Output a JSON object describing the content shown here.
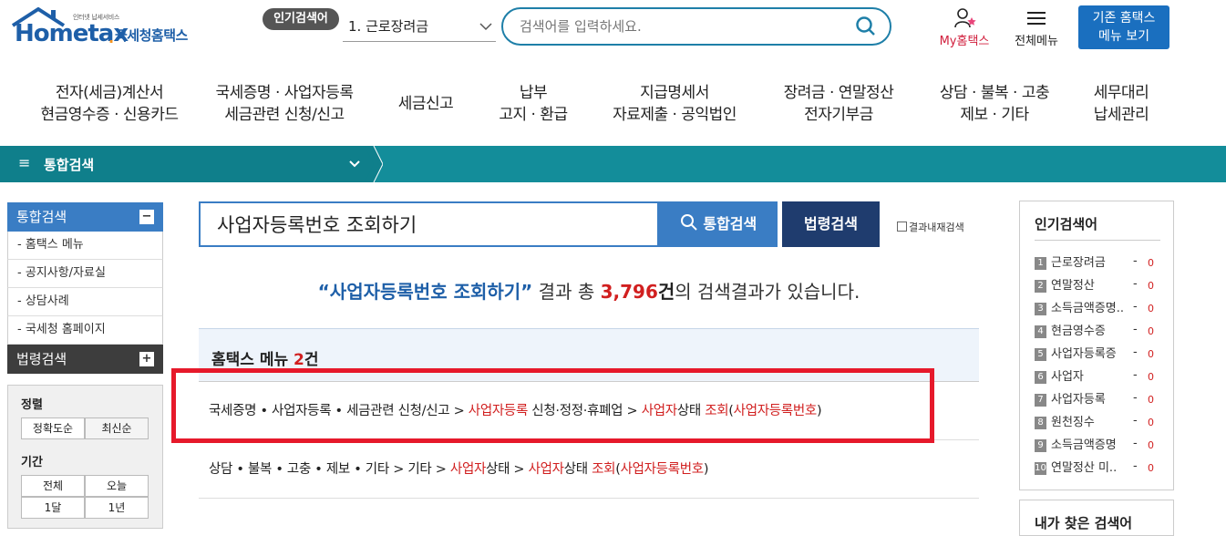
{
  "header": {
    "logo_small": "인터넷 납세서비스",
    "logo_brand": "Hometax",
    "logo_kor": "국세청홈택스",
    "popular_badge": "인기검색어",
    "popular_selected": "1.  근로장려금",
    "search_placeholder": "검색어를 입력하세요.",
    "my_hometax": "My홈택스",
    "all_menu": "전체메뉴",
    "old_menu_line1": "기존 홈택스",
    "old_menu_line2": "메뉴 보기"
  },
  "nav": [
    {
      "l1": "전자(세금)계산서",
      "l2": "현금영수증 · 신용카드"
    },
    {
      "l1": "국세증명 · 사업자등록",
      "l2": "세금관련 신청/신고"
    },
    {
      "l1": "세금신고",
      "l2": ""
    },
    {
      "l1": "납부",
      "l2": "고지 · 환급"
    },
    {
      "l1": "지급명세서",
      "l2": "자료제출 · 공익법인"
    },
    {
      "l1": "장려금 · 연말정산",
      "l2": "전자기부금"
    },
    {
      "l1": "상담 · 불복 · 고충",
      "l2": "제보 · 기타"
    },
    {
      "l1": "세무대리",
      "l2": "납세관리"
    }
  ],
  "teal_bar": {
    "title": "통합검색"
  },
  "left": {
    "integrated_head": "통합검색",
    "items": [
      "- 홈택스 메뉴",
      "- 공지사항/자료실",
      "- 상담사례",
      "- 국세청 홈페이지"
    ],
    "law_head": "법령검색",
    "sort_label": "정렬",
    "sort_options": [
      "정확도순",
      "최신순"
    ],
    "period_label": "기간",
    "period_options": [
      "전체",
      "오늘",
      "1달",
      "1년"
    ]
  },
  "search": {
    "query": "사업자등록번호 조회하기",
    "btn_integrated": "통합검색",
    "btn_law": "법령검색",
    "in_result": "결과내재검색"
  },
  "summary": {
    "query_quoted": "“사업자등록번호 조회하기”",
    "text1": " 결과 총 ",
    "count": "3,796",
    "unit": "건",
    "text2": "의 검색결과가 있습니다."
  },
  "menu_section": {
    "title": "홈택스 메뉴 ",
    "count": "2",
    "unit": "건"
  },
  "results": [
    {
      "parts": [
        {
          "t": "국세증명 • 사업자등록 • 세금관련 신청/신고 > ",
          "red": false
        },
        {
          "t": "사업자등록",
          "red": true
        },
        {
          "t": " 신청·정정·휴폐업 > ",
          "red": false
        },
        {
          "t": "사업자",
          "red": true
        },
        {
          "t": "상태 ",
          "red": false
        },
        {
          "t": "조회",
          "red": true
        },
        {
          "t": "(",
          "red": false
        },
        {
          "t": "사업자등록번호",
          "red": true
        },
        {
          "t": ")",
          "red": false
        }
      ]
    },
    {
      "parts": [
        {
          "t": "상담 • 불복 • 고충 • 제보 • 기타 > 기타 > ",
          "red": false
        },
        {
          "t": "사업자",
          "red": true
        },
        {
          "t": "상태 > ",
          "red": false
        },
        {
          "t": "사업자",
          "red": true
        },
        {
          "t": "상태 ",
          "red": false
        },
        {
          "t": "조회",
          "red": true
        },
        {
          "t": "(",
          "red": false
        },
        {
          "t": "사업자등록번호",
          "red": true
        },
        {
          "t": ")",
          "red": false
        }
      ]
    }
  ],
  "right": {
    "popular_title": "인기검색어",
    "popular": [
      "근로장려금",
      "연말정산",
      "소득금액증명..",
      "현금영수증",
      "사업자등록증",
      "사업자",
      "사업자등록",
      "원천징수",
      "소득금액증명",
      "연말정산 미.."
    ],
    "popular_dash": "-",
    "popular_count": "0",
    "recent_title": "내가 찾은 검색어"
  },
  "colors": {
    "accent": "#3a7dc4",
    "teal": "#138d9a",
    "highlight": "#d11f1f",
    "red_box": "#e6192b"
  }
}
